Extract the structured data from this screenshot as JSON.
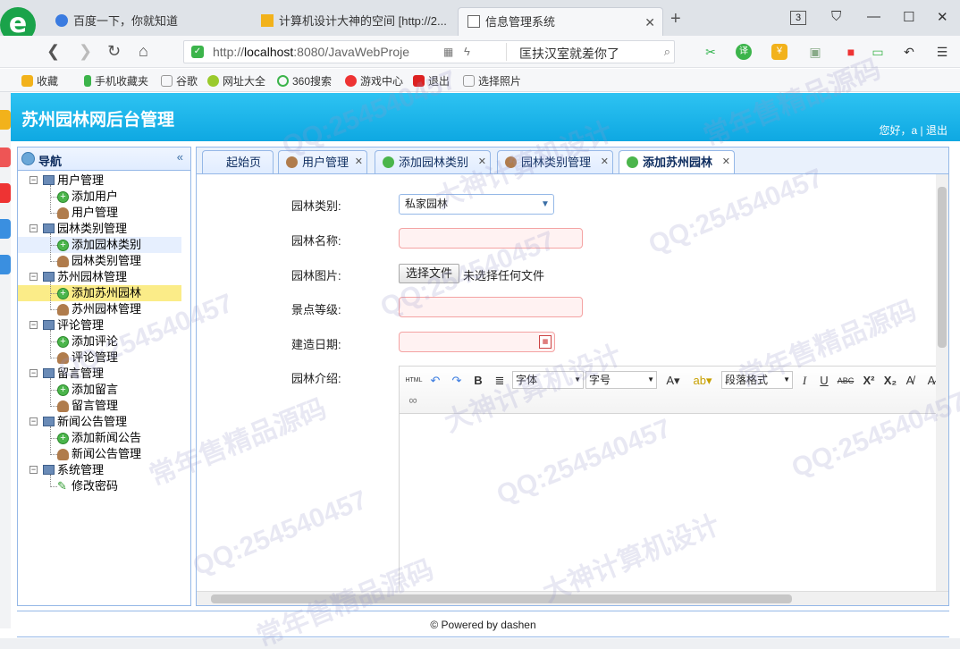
{
  "browser": {
    "tabs": [
      {
        "title": "百度一下，你就知道"
      },
      {
        "title": "计算机设计大神的空间 [http://2..."
      },
      {
        "title": "信息管理系统"
      }
    ],
    "tab_count": "3",
    "url_prefix": "http://",
    "url_host": "localhost",
    "url_rest": ":8080/JavaWebProje",
    "search_text": "匡扶汉室就差你了",
    "bookmarks": [
      "收藏",
      "手机收藏夹",
      "谷歌",
      "网址大全",
      "360搜索",
      "游戏中心",
      "退出",
      "选择照片"
    ]
  },
  "app": {
    "title": "苏州园林网后台管理",
    "user_greeting": "您好，a | 退出"
  },
  "nav": {
    "title": "导航",
    "groups": [
      {
        "label": "用户管理",
        "items": [
          {
            "label": "添加用户",
            "icon": "add"
          },
          {
            "label": "用户管理",
            "icon": "user"
          }
        ]
      },
      {
        "label": "园林类别管理",
        "items": [
          {
            "label": "添加园林类别",
            "icon": "add"
          },
          {
            "label": "园林类别管理",
            "icon": "user"
          }
        ]
      },
      {
        "label": "苏州园林管理",
        "items": [
          {
            "label": "添加苏州园林",
            "icon": "add"
          },
          {
            "label": "苏州园林管理",
            "icon": "user"
          }
        ]
      },
      {
        "label": "评论管理",
        "items": [
          {
            "label": "添加评论",
            "icon": "add"
          },
          {
            "label": "评论管理",
            "icon": "user"
          }
        ]
      },
      {
        "label": "留言管理",
        "items": [
          {
            "label": "添加留言",
            "icon": "add"
          },
          {
            "label": "留言管理",
            "icon": "user"
          }
        ]
      },
      {
        "label": "新闻公告管理",
        "items": [
          {
            "label": "添加新闻公告",
            "icon": "add"
          },
          {
            "label": "新闻公告管理",
            "icon": "user"
          }
        ]
      },
      {
        "label": "系统管理",
        "items": [
          {
            "label": "修改密码",
            "icon": "pen"
          }
        ]
      }
    ]
  },
  "content_tabs": [
    {
      "label": "起始页"
    },
    {
      "label": "用户管理"
    },
    {
      "label": "添加园林类别"
    },
    {
      "label": "园林类别管理"
    },
    {
      "label": "添加苏州园林"
    }
  ],
  "form": {
    "category_label": "园林类别:",
    "category_value": "私家园林",
    "name_label": "园林名称:",
    "image_label": "园林图片:",
    "file_button": "选择文件",
    "file_status": "未选择任何文件",
    "level_label": "景点等级:",
    "date_label": "建造日期:",
    "intro_label": "园林介绍:"
  },
  "editor": {
    "font_dropdown": "字体",
    "size_dropdown": "字号",
    "paragraph_dropdown": "段落格式",
    "html_button": "HTML"
  },
  "footer": {
    "text": "© Powered by dashen"
  },
  "watermarks": [
    "QQ:254540457",
    "常年售精品源码",
    "大神计算机设计"
  ]
}
